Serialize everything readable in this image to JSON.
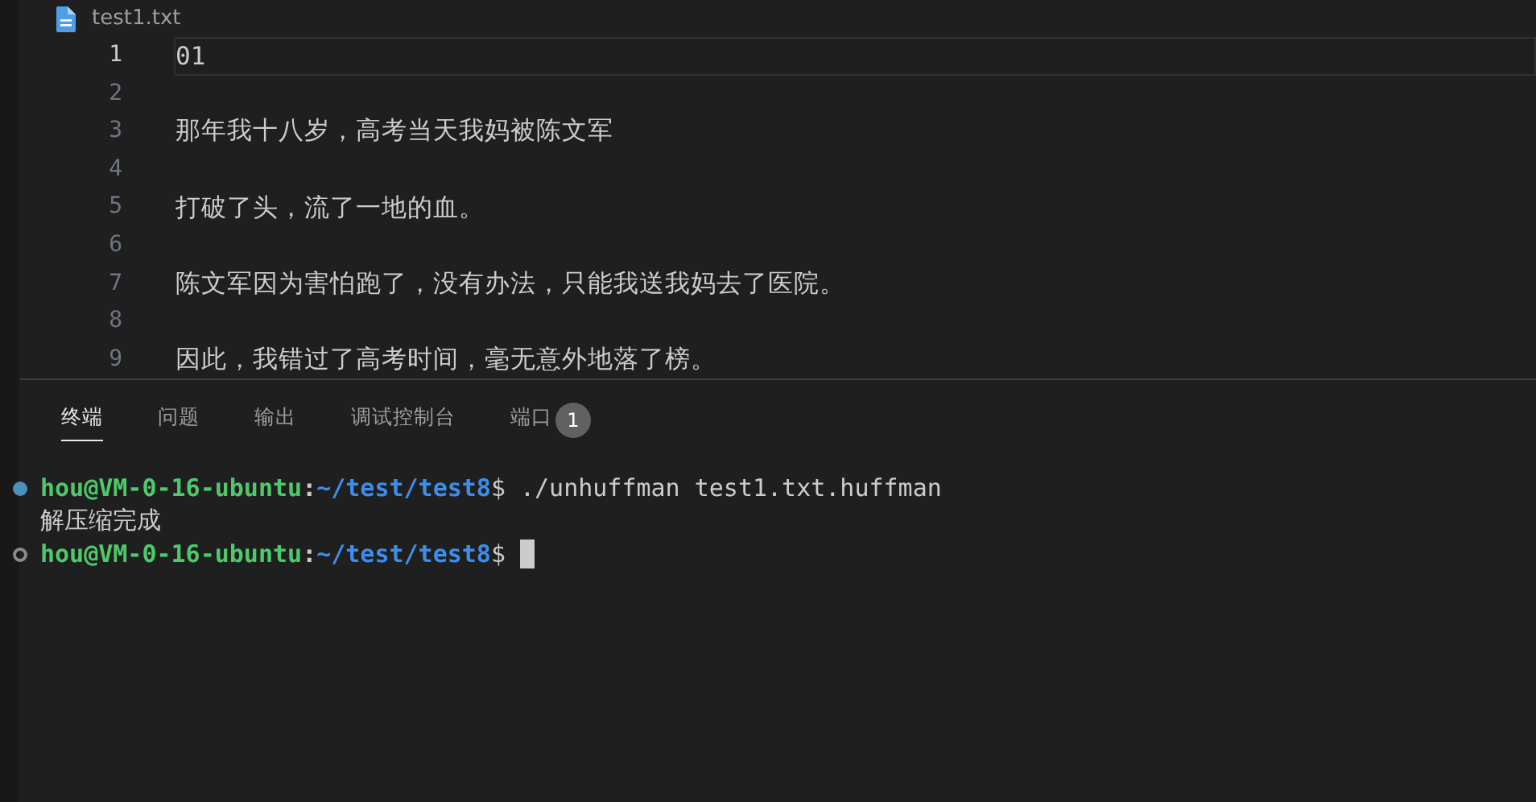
{
  "editor_tab": {
    "title": "test1.txt"
  },
  "lines": [
    {
      "number": "1",
      "text": "01",
      "current": true
    },
    {
      "number": "2",
      "current": false
    },
    {
      "number": "3",
      "text": "那年我十八岁，高考当天我妈被陈文军",
      "current": false
    },
    {
      "number": "4",
      "current": false
    },
    {
      "number": "5",
      "text": "打破了头，流了一地的血。",
      "current": false
    },
    {
      "number": "6",
      "current": false
    },
    {
      "number": "7",
      "text": "陈文军因为害怕跑了，没有办法，只能我送我妈去了医院。",
      "current": false
    },
    {
      "number": "8",
      "current": false
    },
    {
      "number": "9",
      "text": "因此，我错过了高考时间，毫无意外地落了榜。",
      "current": false
    }
  ],
  "panel_tabs": [
    {
      "label": "终端",
      "selected": true
    },
    {
      "label": "问题",
      "selected": false
    },
    {
      "label": "输出",
      "selected": false
    },
    {
      "label": "调试控制台",
      "selected": false
    },
    {
      "label": "端口",
      "selected": false,
      "badge": "1"
    }
  ],
  "terminal": [
    {
      "kind": "prompt",
      "succeeded": true,
      "user": "hou@VM-0-16-ubuntu",
      "sep": ":",
      "path": "~/test/test8",
      "symbol": "$",
      "command": "./unhuffman test1.txt.huffman",
      "cursor": false
    },
    {
      "kind": "output",
      "text": "解压缩完成"
    },
    {
      "kind": "prompt",
      "succeeded": false,
      "user": "hou@VM-0-16-ubuntu",
      "sep": ":",
      "path": "~/test/test8",
      "symbol": "$",
      "cursor": true
    }
  ]
}
